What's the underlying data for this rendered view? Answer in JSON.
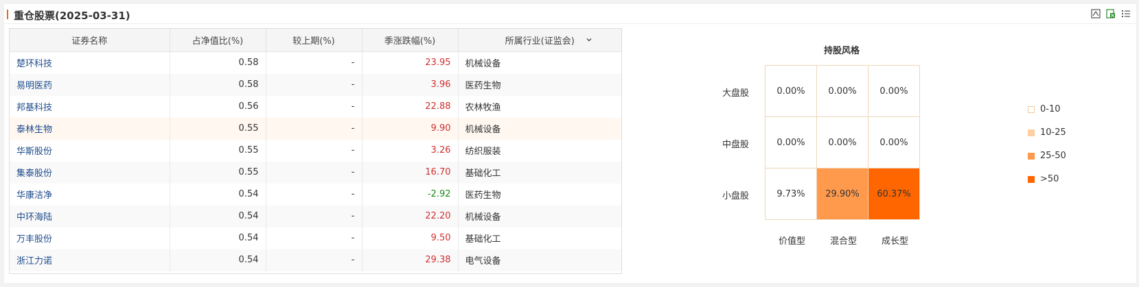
{
  "header": {
    "title": "重仓股票(2025-03-31)"
  },
  "table": {
    "columns": [
      "证券名称",
      "占净值比(%)",
      "较上期(%)",
      "季涨跌幅(%)",
      "所属行业(证监会)"
    ],
    "rows": [
      {
        "name": "楚环科技",
        "ratio": "0.58",
        "change": "-",
        "quarter": "23.95",
        "industry": "机械设备",
        "dir": "up"
      },
      {
        "name": "易明医药",
        "ratio": "0.58",
        "change": "-",
        "quarter": "3.96",
        "industry": "医药生物",
        "dir": "up"
      },
      {
        "name": "邦基科技",
        "ratio": "0.56",
        "change": "-",
        "quarter": "22.88",
        "industry": "农林牧渔",
        "dir": "up"
      },
      {
        "name": "泰林生物",
        "ratio": "0.55",
        "change": "-",
        "quarter": "9.90",
        "industry": "机械设备",
        "dir": "up"
      },
      {
        "name": "华斯股份",
        "ratio": "0.55",
        "change": "-",
        "quarter": "3.26",
        "industry": "纺织服装",
        "dir": "up"
      },
      {
        "name": "集泰股份",
        "ratio": "0.55",
        "change": "-",
        "quarter": "16.70",
        "industry": "基础化工",
        "dir": "up"
      },
      {
        "name": "华康洁净",
        "ratio": "0.54",
        "change": "-",
        "quarter": "-2.92",
        "industry": "医药生物",
        "dir": "down"
      },
      {
        "name": "中环海陆",
        "ratio": "0.54",
        "change": "-",
        "quarter": "22.20",
        "industry": "机械设备",
        "dir": "up"
      },
      {
        "name": "万丰股份",
        "ratio": "0.54",
        "change": "-",
        "quarter": "9.50",
        "industry": "基础化工",
        "dir": "up"
      },
      {
        "name": "浙江力诺",
        "ratio": "0.54",
        "change": "-",
        "quarter": "29.38",
        "industry": "电气设备",
        "dir": "up"
      }
    ]
  },
  "style_box": {
    "title": "持股风格",
    "rows": [
      "大盘股",
      "中盘股",
      "小盘股"
    ],
    "cols": [
      "价值型",
      "混合型",
      "成长型"
    ],
    "values": [
      [
        "0.00%",
        "0.00%",
        "0.00%"
      ],
      [
        "0.00%",
        "0.00%",
        "0.00%"
      ],
      [
        "9.73%",
        "29.90%",
        "60.37%"
      ]
    ],
    "fills": [
      [
        "#ffffff",
        "#ffffff",
        "#ffffff"
      ],
      [
        "#ffffff",
        "#ffffff",
        "#ffffff"
      ],
      [
        "#ffffff",
        "#ff9a4d",
        "#ff6600"
      ]
    ],
    "legend": [
      {
        "label": "0-10",
        "color": "#ffffff"
      },
      {
        "label": "10-25",
        "color": "#ffcfa3"
      },
      {
        "label": "25-50",
        "color": "#ff9a4d"
      },
      {
        "label": ">50",
        "color": "#ff6600"
      }
    ]
  },
  "colors": {
    "up": "#d0302f",
    "down": "#1a8a1a",
    "accent": "#e06b1a",
    "link": "#1d4b8b"
  }
}
